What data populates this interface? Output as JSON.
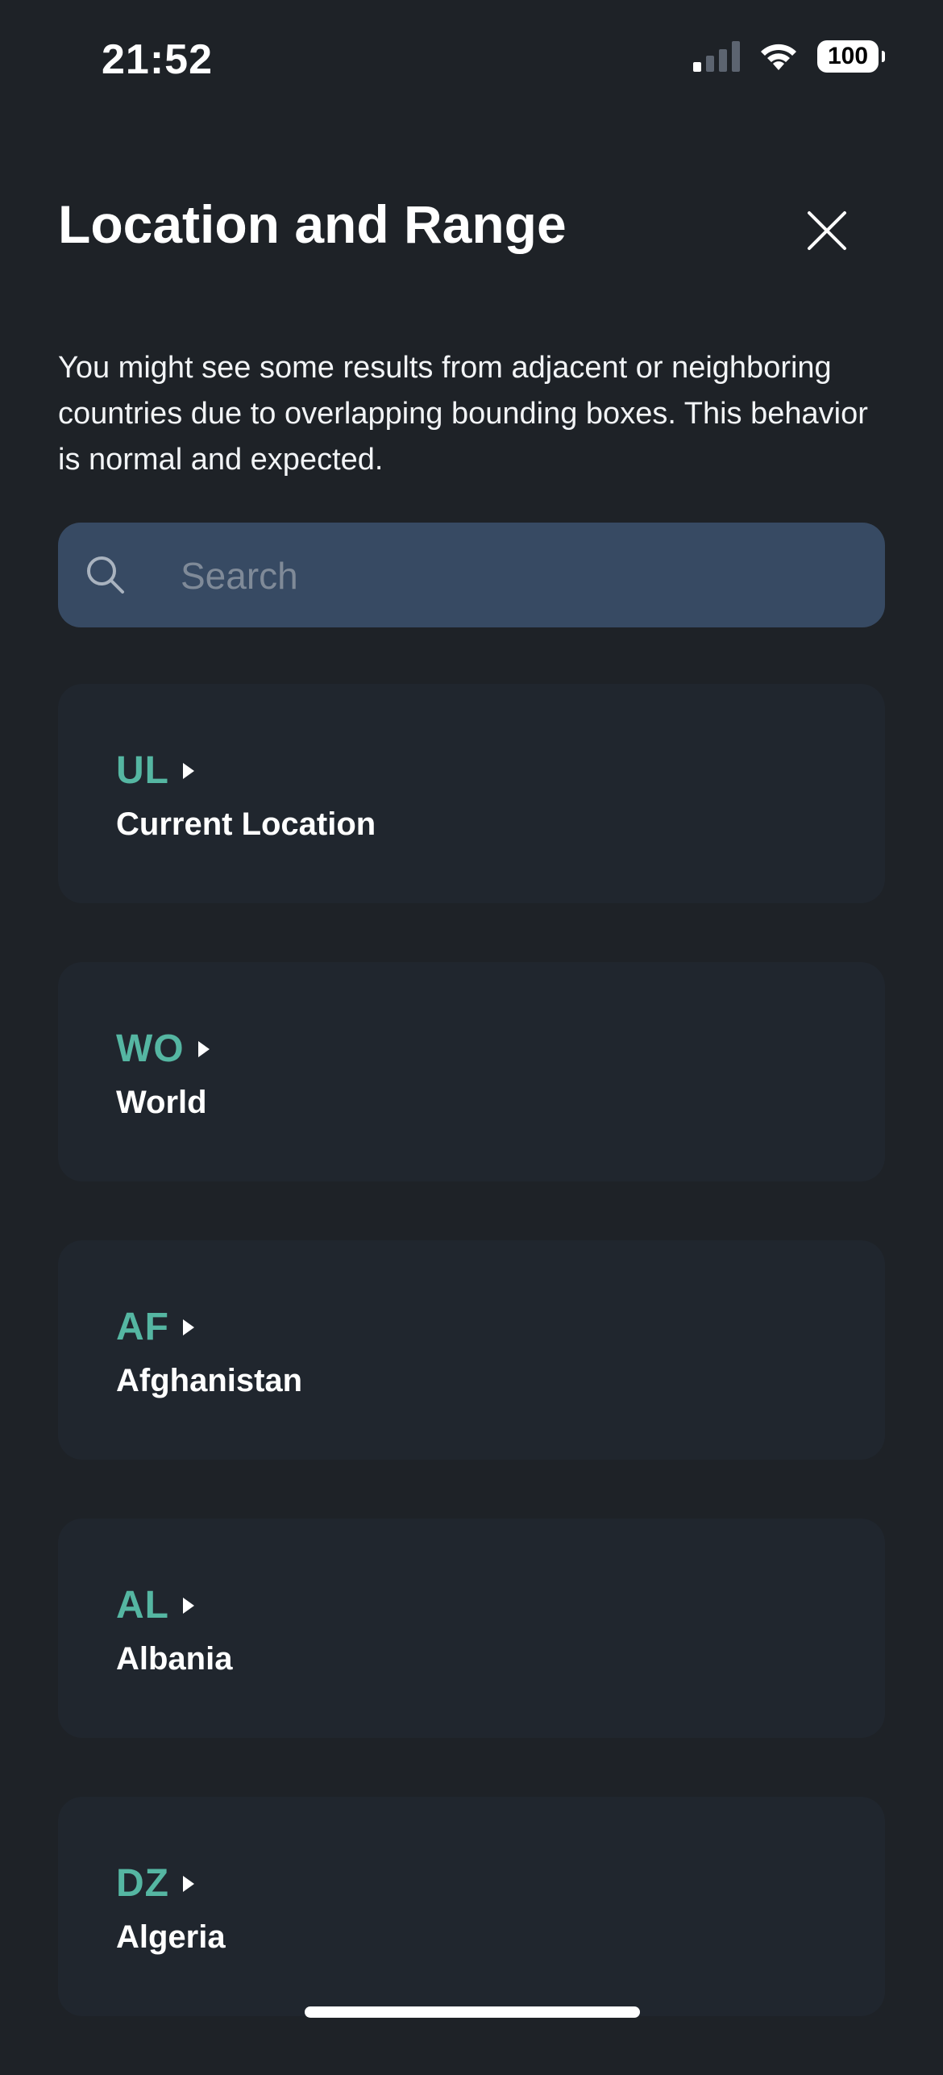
{
  "status_bar": {
    "time": "21:52",
    "battery": "100"
  },
  "header": {
    "title": "Location and Range",
    "close_icon": "close-icon"
  },
  "description": "You might see some results from adjacent or neighboring countries due to overlapping bounding boxes. This behavior is normal and expected.",
  "search": {
    "placeholder": "Search",
    "value": "",
    "icon": "search-icon"
  },
  "locations": [
    {
      "code": "UL",
      "name": "Current Location"
    },
    {
      "code": "WO",
      "name": "World"
    },
    {
      "code": "AF",
      "name": "Afghanistan"
    },
    {
      "code": "AL",
      "name": "Albania"
    },
    {
      "code": "DZ",
      "name": "Algeria"
    }
  ],
  "colors": {
    "background": "#1e2227",
    "card": "#20262e",
    "search_bg": "#374a63",
    "accent": "#55b6a2",
    "text": "#ffffff"
  }
}
